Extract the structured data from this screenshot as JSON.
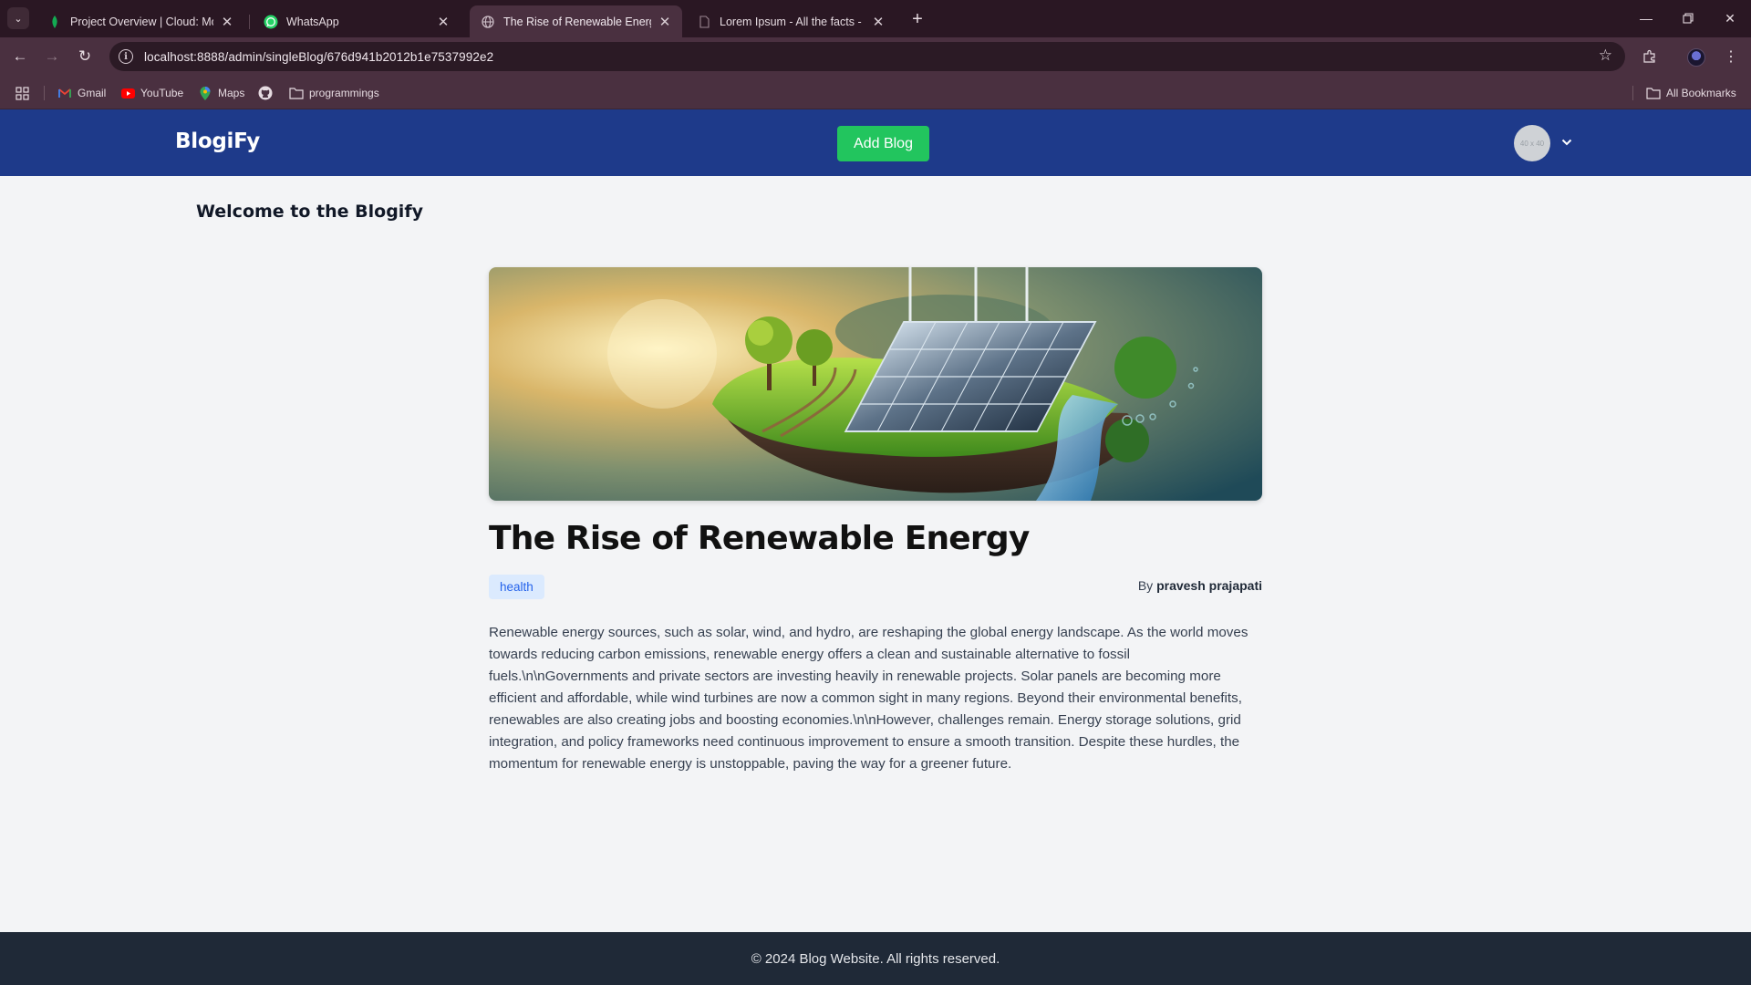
{
  "browser": {
    "tabs": [
      {
        "title": "Project Overview | Cloud: Mong",
        "active": false
      },
      {
        "title": "WhatsApp",
        "active": false
      },
      {
        "title": "The Rise of Renewable Energy",
        "active": true
      },
      {
        "title": "Lorem Ipsum - All the facts - Li",
        "active": false
      }
    ],
    "url": "localhost:8888/admin/singleBlog/676d941b2012b1e7537992e2",
    "bookmarks": [
      {
        "label": "Gmail"
      },
      {
        "label": "YouTube"
      },
      {
        "label": "Maps"
      },
      {
        "label": "programmings"
      }
    ],
    "all_bookmarks": "All Bookmarks"
  },
  "header": {
    "brand": "BlogiFy",
    "add_blog_label": "Add Blog",
    "avatar_placeholder": "40 x 40"
  },
  "page": {
    "welcome": "Welcome to the Blogify"
  },
  "post": {
    "title": "The Rise of Renewable Energy",
    "tag": "health",
    "by_label": "By",
    "author": "pravesh prajapati",
    "body": "Renewable energy sources, such as solar, wind, and hydro, are reshaping the global energy landscape. As the world moves towards reducing carbon emissions, renewable energy offers a clean and sustainable alternative to fossil fuels.\\n\\nGovernments and private sectors are investing heavily in renewable projects. Solar panels are becoming more efficient and affordable, while wind turbines are now a common sight in many regions. Beyond their environmental benefits, renewables are also creating jobs and boosting economies.\\n\\nHowever, challenges remain. Energy storage solutions, grid integration, and policy frameworks need continuous improvement to ensure a smooth transition. Despite these hurdles, the momentum for renewable energy is unstoppable, paving the way for a greener future."
  },
  "footer": {
    "text": "© 2024 Blog Website. All rights reserved."
  },
  "colors": {
    "header_bg": "#1e3a8a",
    "add_button": "#22c55e",
    "footer_bg": "#1f2937",
    "tag_bg": "#dbeafe",
    "tag_text": "#2563eb",
    "browser_frame": "#4a3040"
  },
  "icons": {
    "tab_1": "mongodb-leaf-icon",
    "tab_2": "whatsapp-icon",
    "tab_3": "globe-icon",
    "tab_4": "document-icon",
    "bookmark_github": "github-icon"
  }
}
